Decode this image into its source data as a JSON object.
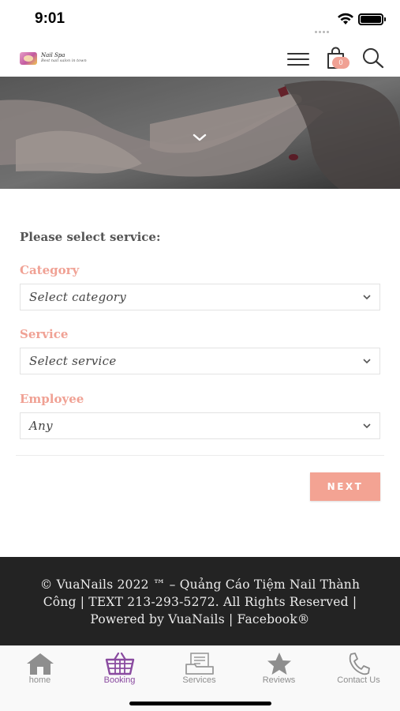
{
  "status_bar": {
    "time": "9:01"
  },
  "header": {
    "logo_line1": "Nail Spa",
    "logo_line2": "Best nail salon in town",
    "cart_count": "0"
  },
  "form": {
    "title": "Please select service:",
    "category_label": "Category",
    "category_value": "Select category",
    "service_label": "Service",
    "service_value": "Select service",
    "employee_label": "Employee",
    "employee_value": "Any",
    "next_label": "NEXT"
  },
  "footer": {
    "text": "© VuaNails 2022 ™ – Quảng Cáo Tiệm Nail Thành Công | TEXT 213-293-5272. All Rights Reserved | Powered by VuaNails | Facebook®"
  },
  "tabs": [
    {
      "label": "home",
      "icon": "home-icon",
      "active": false
    },
    {
      "label": "Booking",
      "icon": "basket-icon",
      "active": true
    },
    {
      "label": "Services",
      "icon": "services-icon",
      "active": false
    },
    {
      "label": "Reviews",
      "icon": "star-icon",
      "active": false
    },
    {
      "label": "Contact Us",
      "icon": "phone-icon",
      "active": false
    }
  ],
  "colors": {
    "accent": "#f0a194",
    "active_tab": "#8a4ba0",
    "footer_bg": "#232323"
  }
}
